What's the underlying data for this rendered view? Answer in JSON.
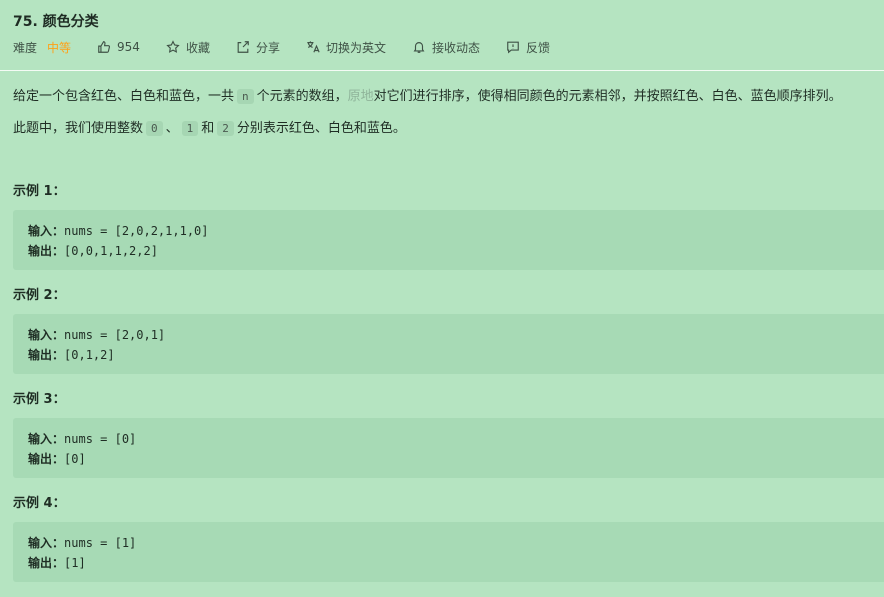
{
  "problem": {
    "title": "75. 颜色分类",
    "difficulty_label": "难度",
    "difficulty_value": "中等",
    "likes": "954",
    "favorite_label": "收藏",
    "share_label": "分享",
    "switch_lang_label": "切换为英文",
    "subscribe_label": "接收动态",
    "feedback_label": "反馈"
  },
  "description": {
    "p1_a": "给定一个包含红色、白色和蓝色，一共",
    "p1_code": "n",
    "p1_b": "个元素的数组，",
    "p1_faded": "原地",
    "p1_c": "对它们进行排序，使得相同颜色的元素相邻，并按照红色、白色、蓝色顺序排列。",
    "p2_a": "此题中，我们使用整数",
    "p2_code0": "0",
    "p2_sep": "、",
    "p2_code1": "1",
    "p2_and": "和",
    "p2_code2": "2",
    "p2_b": "分别表示红色、白色和蓝色。"
  },
  "examples": [
    {
      "title": "示例 1：",
      "input_label": "输入：",
      "input": "nums = [2,0,2,1,1,0]",
      "output_label": "输出：",
      "output": "[0,0,1,1,2,2]"
    },
    {
      "title": "示例 2：",
      "input_label": "输入：",
      "input": "nums = [2,0,1]",
      "output_label": "输出：",
      "output": "[0,1,2]"
    },
    {
      "title": "示例 3：",
      "input_label": "输入：",
      "input": "nums = [0]",
      "output_label": "输出：",
      "output": "[0]"
    },
    {
      "title": "示例 4：",
      "input_label": "输入：",
      "input": "nums = [1]",
      "output_label": "输出：",
      "output": "[1]"
    }
  ],
  "colors": {
    "background": "#b5e4c1",
    "code_block": "#a7dab5",
    "difficulty_medium": "#ffa116"
  }
}
